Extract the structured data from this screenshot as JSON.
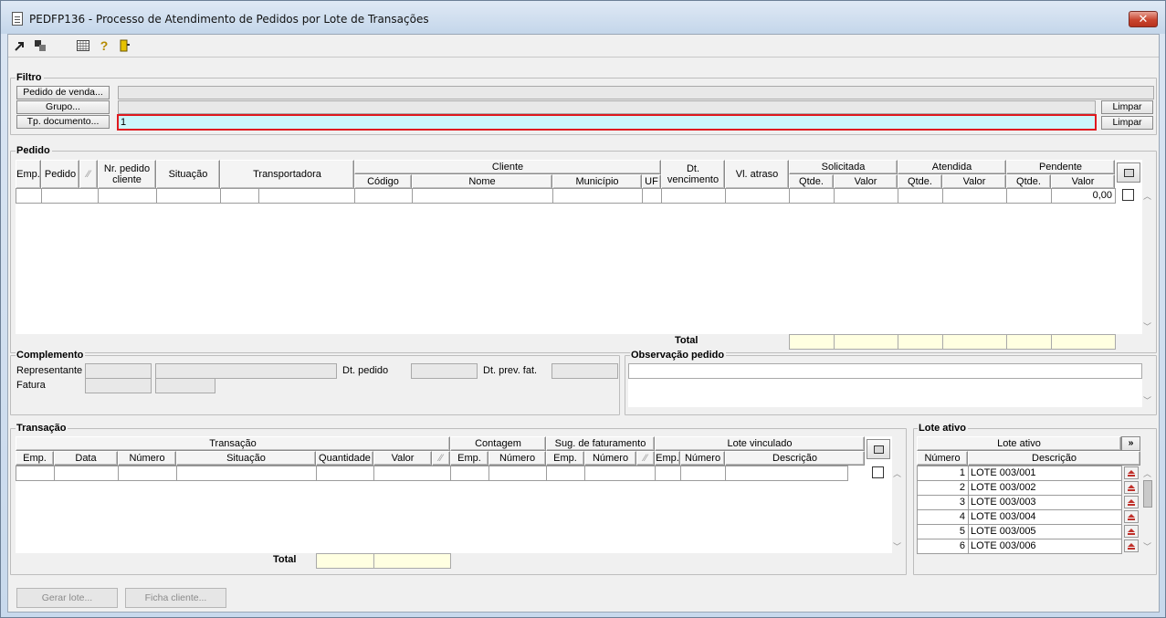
{
  "window": {
    "title": "PEDFP136 - Processo de Atendimento de Pedidos por Lote de Transações",
    "close_label": "✕"
  },
  "toolbar": {
    "icons": [
      "export-icon",
      "copy-icon",
      "calendar-grid-icon",
      "help-icon",
      "exit-door-icon"
    ]
  },
  "filtro": {
    "title": "Filtro",
    "pedido_btn": "Pedido de venda...",
    "grupo_btn": "Grupo...",
    "tp_doc_btn": "Tp. documento...",
    "tp_doc_value": "1",
    "limpar1": "Limpar",
    "limpar2": "Limpar"
  },
  "pedido": {
    "title": "Pedido",
    "headers": {
      "emp": "Emp.",
      "pedido": "Pedido",
      "nr_pedido_cliente": "Nr. pedido cliente",
      "situacao": "Situação",
      "transportadora": "Transportadora",
      "cliente": "Cliente",
      "codigo": "Código",
      "nome": "Nome",
      "municipio": "Município",
      "uf": "UF",
      "dt_vencimento": "Dt. vencimento",
      "vl_atraso": "Vl. atraso",
      "solicitada": "Solicitada",
      "atendida": "Atendida",
      "pendente": "Pendente",
      "qtde": "Qtde.",
      "valor": "Valor"
    },
    "row": {
      "pendente_valor": "0,00"
    },
    "total_label": "Total"
  },
  "complemento": {
    "title": "Complemento",
    "representante": "Representante",
    "fatura": "Fatura",
    "dt_pedido": "Dt. pedido",
    "dt_prev_fat": "Dt. prev. fat."
  },
  "observacao": {
    "title": "Observação pedido"
  },
  "transacao": {
    "title": "Transação",
    "headers": {
      "transacao": "Transação",
      "contagem": "Contagem",
      "sug_faturamento": "Sug. de faturamento",
      "lote_vinculado": "Lote vinculado",
      "emp": "Emp.",
      "data": "Data",
      "numero": "Número",
      "situacao": "Situação",
      "quantidade": "Quantidade",
      "valor": "Valor",
      "descricao": "Descrição"
    },
    "total_label": "Total"
  },
  "lote_ativo": {
    "title": "Lote ativo",
    "header": "Lote ativo",
    "expand": "»",
    "col_numero": "Número",
    "col_descricao": "Descrição",
    "rows": [
      {
        "numero": "1",
        "descricao": "LOTE 003/001"
      },
      {
        "numero": "2",
        "descricao": "LOTE 003/002"
      },
      {
        "numero": "3",
        "descricao": "LOTE 003/003"
      },
      {
        "numero": "4",
        "descricao": "LOTE 003/004"
      },
      {
        "numero": "5",
        "descricao": "LOTE 003/005"
      },
      {
        "numero": "6",
        "descricao": "LOTE 003/006"
      }
    ]
  },
  "footer": {
    "gerar_lote": "Gerar lote...",
    "ficha_cliente": "Ficha cliente..."
  }
}
